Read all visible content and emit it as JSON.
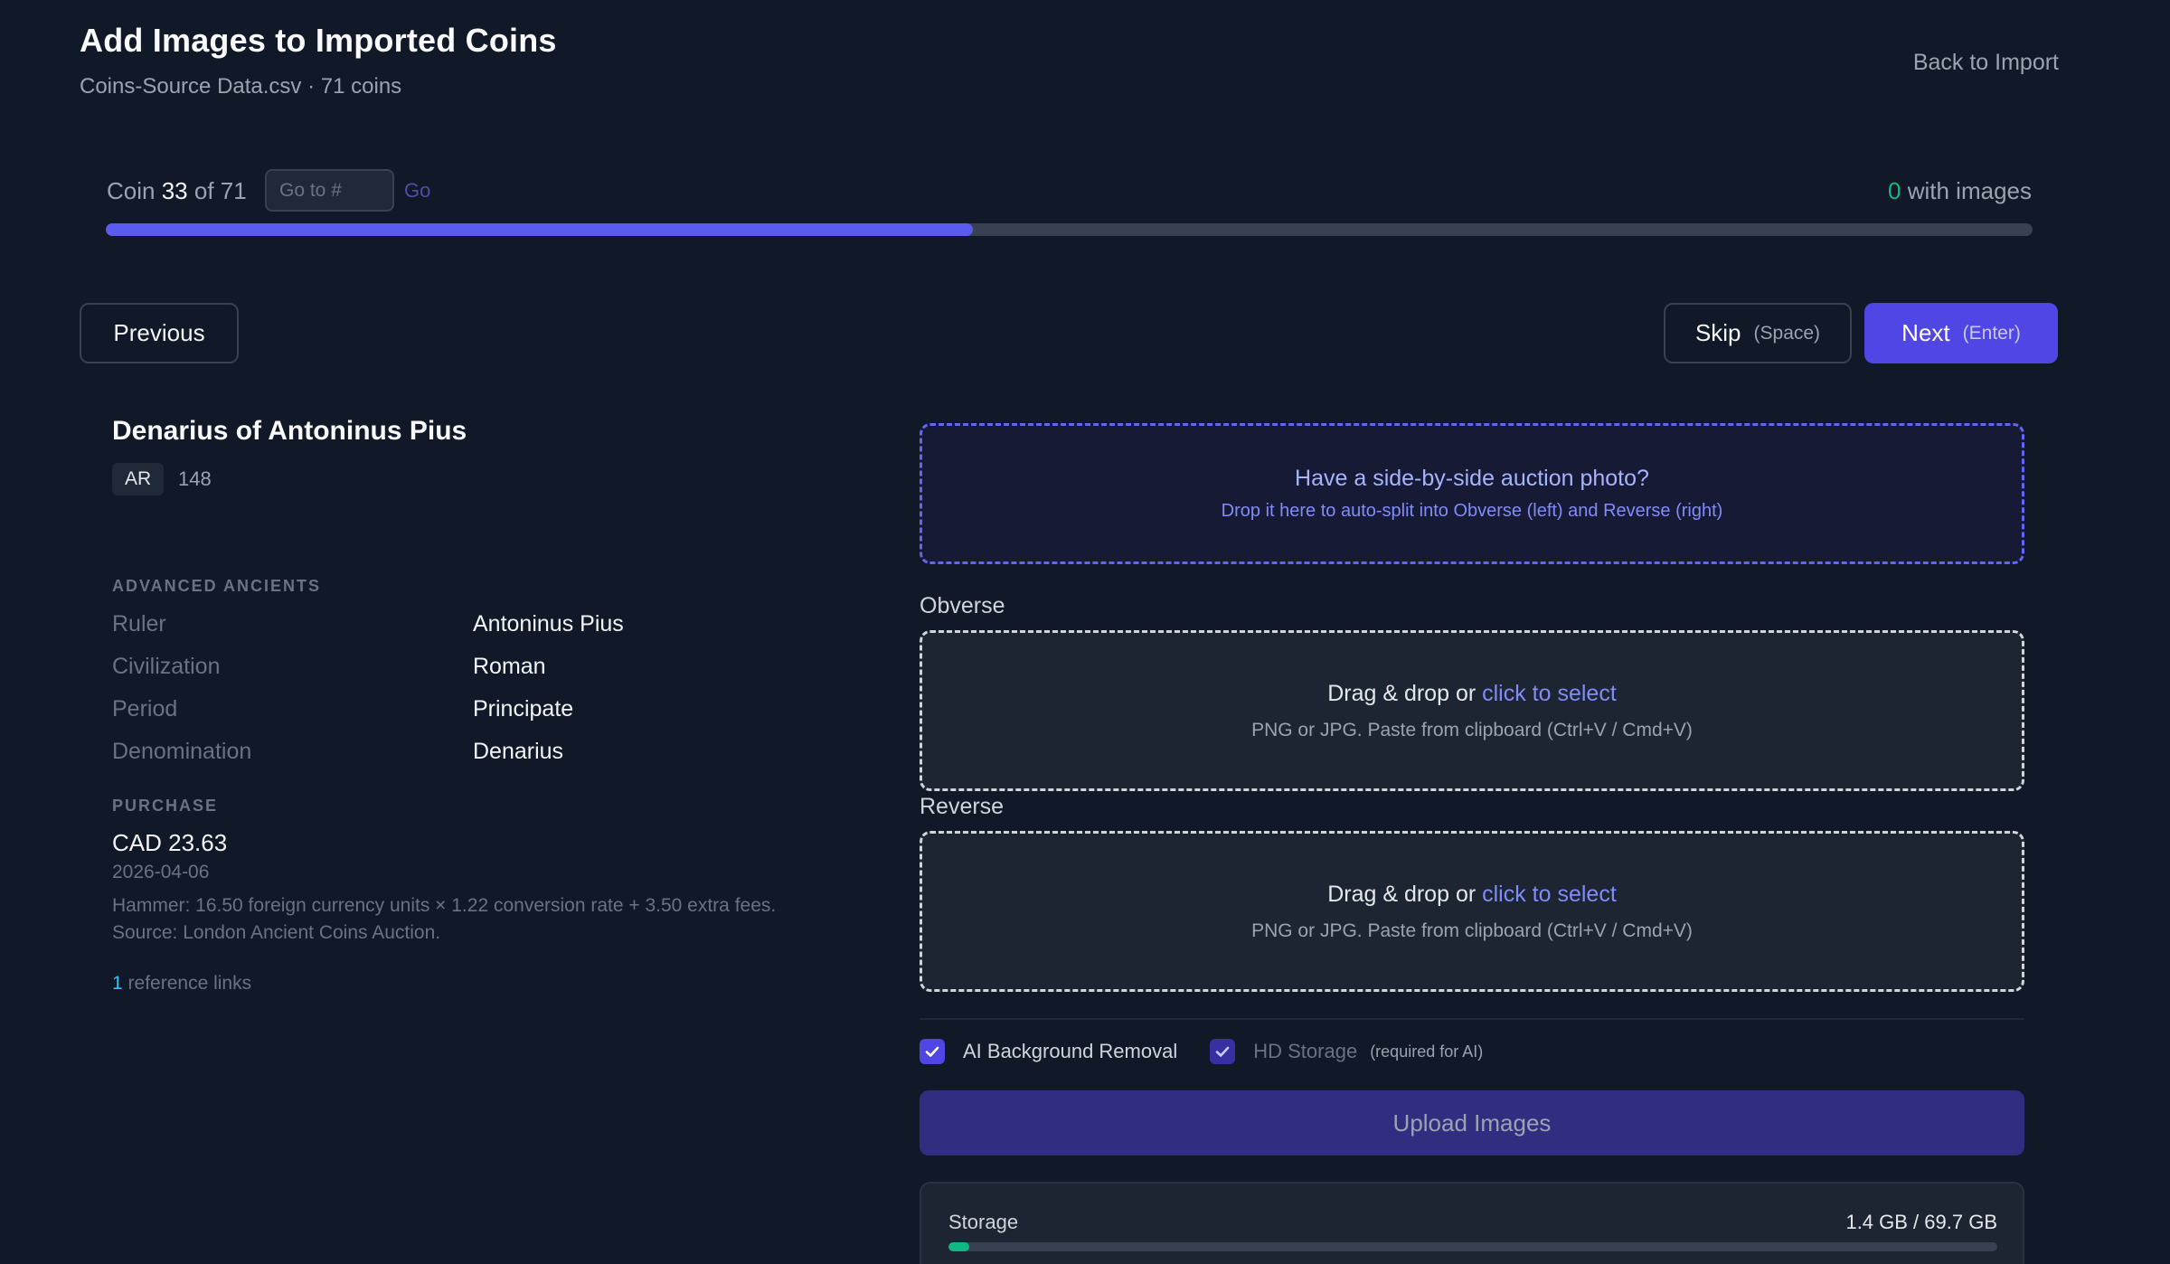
{
  "header": {
    "title": "Add Images to Imported Coins",
    "file_name": "Coins-Source Data.csv",
    "separator": "·",
    "coin_total_label": "71 coins",
    "back_label": "Back to Import"
  },
  "progress": {
    "coin_word": "Coin",
    "current": "33",
    "of_word": "of",
    "total": "71",
    "goto_placeholder": "Go to #",
    "go_label": "Go",
    "with_images_count": "0",
    "with_images_label": "with images",
    "fraction_complete": 0.45,
    "accent_color": "#5b5bf0"
  },
  "nav": {
    "previous_label": "Previous",
    "skip_label": "Skip",
    "skip_hint": "(Space)",
    "next_label": "Next",
    "next_hint": "(Enter)"
  },
  "coin": {
    "name": "Denarius of Antoninus Pius",
    "metal": "AR",
    "year": "148",
    "advanced_heading": "ADVANCED ANCIENTS",
    "attributes": [
      {
        "label": "Ruler",
        "value": "Antoninus Pius"
      },
      {
        "label": "Civilization",
        "value": "Roman"
      },
      {
        "label": "Period",
        "value": "Principate"
      },
      {
        "label": "Denomination",
        "value": "Denarius"
      }
    ],
    "purchase_heading": "PURCHASE",
    "price": "CAD 23.63",
    "purchase_date": "2026-04-06",
    "purchase_note": "Hammer: 16.50 foreign currency units × 1.22 conversion rate + 3.50 extra fees. Source: London Ancient Coins Auction.",
    "ref_count": "1",
    "ref_label": "reference links"
  },
  "upload": {
    "split_title": "Have a side-by-side auction photo?",
    "split_subtitle": "Drop it here to auto-split into Obverse (left) and Reverse (right)",
    "obverse_label": "Obverse",
    "reverse_label": "Reverse",
    "drop_text": "Drag & drop or",
    "drop_link": "click to select",
    "drop_hint": "PNG or JPG. Paste from clipboard (Ctrl+V / Cmd+V)",
    "ai_removal_label": "AI Background Removal",
    "ai_removal_checked": true,
    "hd_storage_label": "HD Storage",
    "hd_storage_note": "(required for AI)",
    "hd_storage_checked": true,
    "upload_button_label": "Upload Images"
  },
  "storage": {
    "label": "Storage",
    "used": "1.4 GB",
    "total": "69.7 GB",
    "value_text": "1.4 GB / 69.7 GB",
    "fraction_used": 0.02,
    "bar_color": "#10b981"
  }
}
